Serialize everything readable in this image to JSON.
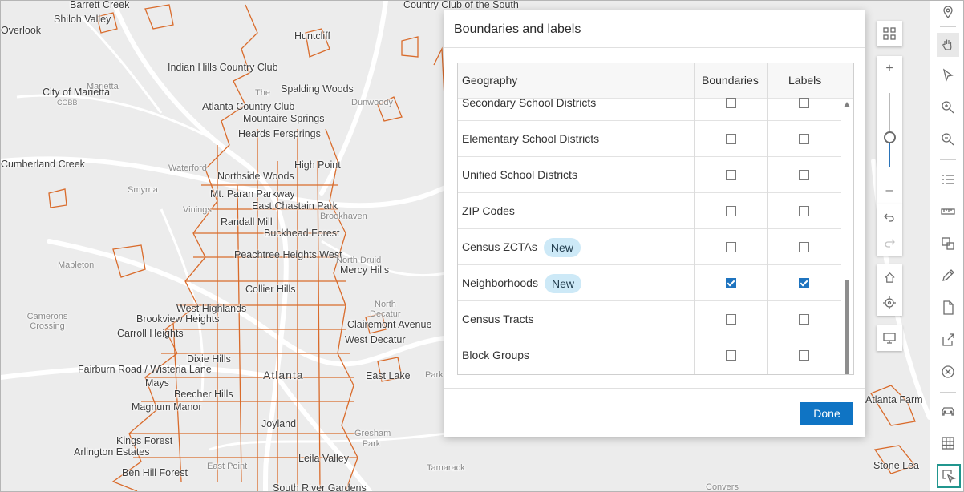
{
  "map_labels": {
    "barrett_creek": "Barrett Creek",
    "shiloh_valley": "Shiloh Valley",
    "overlook": "Overlook",
    "huntcliff": "Huntcliff",
    "country_club_south": "Country Club of the South",
    "indian_hills": "Indian Hills Country Club",
    "city_of_marietta": "City of Marietta",
    "marietta": "Marietta",
    "cobb": "COBB",
    "the": "The",
    "spalding_woods": "Spalding Woods",
    "dunwoody": "Dunwoody",
    "atlanta_cc": "Atlanta Country Club",
    "mountaire": "Mountaire Springs",
    "heards": "Heards Fersprings",
    "cumberland": "Cumberland Creek",
    "waterford": "Waterford",
    "high_point": "High Point",
    "northside_woods": "Northside Woods",
    "smyrna": "Smyrna",
    "mt_paran": "Mt. Paran Parkway",
    "vinings": "Vinings",
    "east_chastain": "East Chastain Park",
    "randall_mill": "Randall Mill",
    "brookhaven": "Brookhaven",
    "buckhead": "Buckhead Forest",
    "mableton": "Mableton",
    "peachtree_heights": "Peachtree Heights West",
    "north_druid": "North Druid",
    "mercy_hills": "Mercy Hills",
    "collier_hills": "Collier Hills",
    "north": "North",
    "decatur": "Decatur",
    "cameron_crossing": "Camerons Crossing",
    "west_highlands": "West Highlands",
    "brookview": "Brookview Heights",
    "clairemont": "Clairemont Avenue",
    "carroll_heights": "Carroll Heights",
    "west_decatur": "West Decatur",
    "dixie_hills": "Dixie Hills",
    "fairburn": "Fairburn Road / Wisteria Lane",
    "atlanta": "Atlanta",
    "east_lake": "East Lake",
    "mays": "Mays",
    "beecher_hills": "Beecher Hills",
    "magnum_manor": "Magnum Manor",
    "joyland": "Joyland",
    "kings_forest": "Kings Forest",
    "gresham_park": "Gresham Park",
    "arlington": "Arlington Estates",
    "leila_valley": "Leila Valley",
    "ben_hill": "Ben Hill Forest",
    "east_point": "East Point",
    "tamarack": "Tamarack",
    "south_river": "South River Gardens",
    "convers": "Convers",
    "atlanta_farm": "Atlanta Farm",
    "stone_lea": "Stone Lea",
    "park": "Park"
  },
  "dialog": {
    "title": "Boundaries and labels",
    "columns": {
      "geography": "Geography",
      "boundaries": "Boundaries",
      "labels": "Labels"
    },
    "rows": [
      {
        "name": "Secondary School Districts",
        "boundaries": false,
        "labels": false
      },
      {
        "name": "Elementary School Districts",
        "boundaries": false,
        "labels": false
      },
      {
        "name": "Unified School Districts",
        "boundaries": false,
        "labels": false
      },
      {
        "name": "ZIP Codes",
        "boundaries": false,
        "labels": false
      },
      {
        "name": "Census ZCTAs",
        "badge": "New",
        "boundaries": false,
        "labels": false
      },
      {
        "name": "Neighborhoods",
        "badge": "New",
        "boundaries": true,
        "labels": true
      },
      {
        "name": "Census Tracts",
        "boundaries": false,
        "labels": false
      },
      {
        "name": "Block Groups",
        "boundaries": false,
        "labels": false
      }
    ],
    "done_label": "Done"
  },
  "zoom": {
    "plus": "+",
    "minus": "–"
  },
  "colors": {
    "boundary": "#d96b2b",
    "accent": "#0f74c4",
    "selected_tool": "#21968e"
  }
}
